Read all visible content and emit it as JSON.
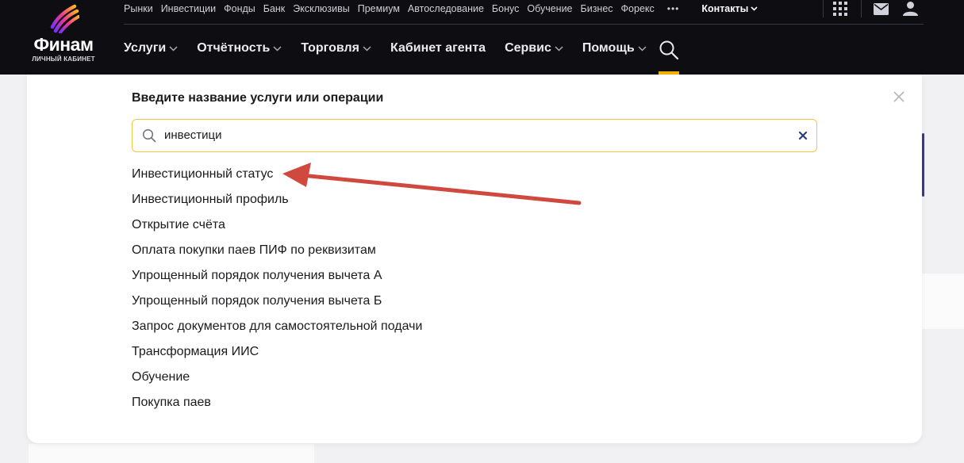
{
  "header": {
    "logo_text": "Финам",
    "logo_sub": "ЛИЧНЫЙ КАБИНЕТ",
    "top_nav": [
      "Рынки",
      "Инвестиции",
      "Фонды",
      "Банк",
      "Эксклюзивы",
      "Премиум",
      "Автоследование",
      "Бонус",
      "Обучение",
      "Бизнес",
      "Форекс"
    ],
    "more": "•••",
    "contacts": "Контакты",
    "main_nav": [
      {
        "label": "Услуги",
        "dropdown": true
      },
      {
        "label": "Отчётность",
        "dropdown": true
      },
      {
        "label": "Торговля",
        "dropdown": true
      },
      {
        "label": "Кабинет агента",
        "dropdown": false
      },
      {
        "label": "Сервис",
        "dropdown": true
      },
      {
        "label": "Помощь",
        "dropdown": true
      }
    ],
    "accent_color": "#f4b400"
  },
  "search_modal": {
    "title": "Введите название услуги или операции",
    "query": "инвестици",
    "results": [
      "Инвестиционный статус",
      "Инвестиционный профиль",
      "Открытие счёта",
      "Оплата покупки паев ПИФ по реквизитам",
      "Упрощенный порядок получения вычета А",
      "Упрощенный порядок получения вычета Б",
      "Запрос документов для самостоятельной подачи",
      "Трансформация ИИС",
      "Обучение",
      "Покупка паев"
    ],
    "input_border_color": "#f5c542",
    "annotation_arrow_color": "#d0493f"
  }
}
